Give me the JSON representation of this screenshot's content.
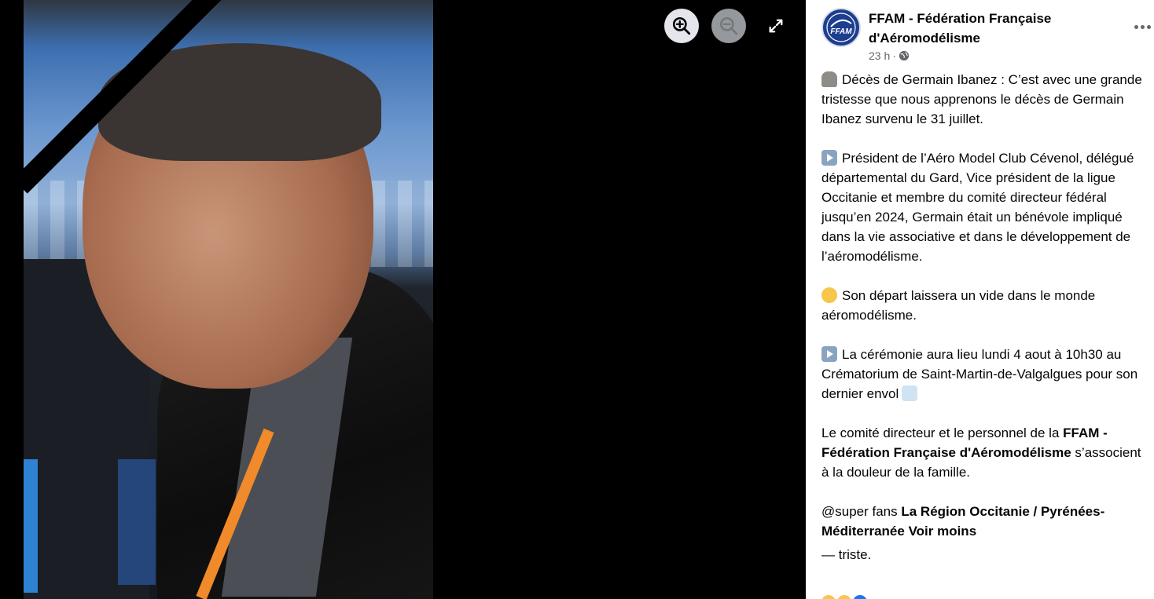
{
  "viewer": {
    "zoom_in_icon": "zoom-in-icon",
    "zoom_out_icon": "zoom-out-icon",
    "fullscreen_icon": "fullscreen-icon"
  },
  "post": {
    "page_name": "FFAM - Fédération Française d'Aéromodélisme",
    "avatar_text": "FFAM",
    "time": "23 h",
    "separator": "·",
    "audience_icon": "globe-icon",
    "more_icon": "more-horizontal-icon",
    "paragraphs": {
      "p1": "Décès de Germain Ibanez : C’est avec une grande tristesse que nous apprenons le décès de Germain Ibanez survenu le 31 juillet.",
      "p2": "Président de l’Aéro Model Club Cévenol, délégué départemental du Gard, Vice président de la ligue Occitanie et membre du comité directeur fédéral jusqu’en 2024, Germain était un bénévole impliqué dans la vie associative et dans le développement de l’aéromodélisme.",
      "p3": "Son départ laissera un vide dans le monde aéromodélisme.",
      "p4": "La cérémonie aura lieu lundi 4 aout à 10h30 au Crématorium de Saint-Martin-de-Valgalgues pour son dernier envol",
      "p5_pre": "Le comité directeur et le personnel de la ",
      "p5_link": "FFAM - Fédération Française d'Aéromodélisme",
      "p5_post": " s’associent à la douleur de la famille.",
      "p6_pre": "@super fans ",
      "p6_link": "La Région Occitanie / Pyrénées-Méditerranée",
      "p6_toggle": "Voir moins",
      "p7": "— triste."
    },
    "emojis": {
      "e1": "headstone-emoji",
      "e2": "play-button-emoji",
      "e3": "pensive-face-emoji",
      "e4": "play-button-emoji",
      "e5": "airplane-departure-emoji"
    }
  },
  "colors": {
    "brand_blue": "#1c3e8f",
    "text_primary": "#050505",
    "text_secondary": "#65676b"
  }
}
